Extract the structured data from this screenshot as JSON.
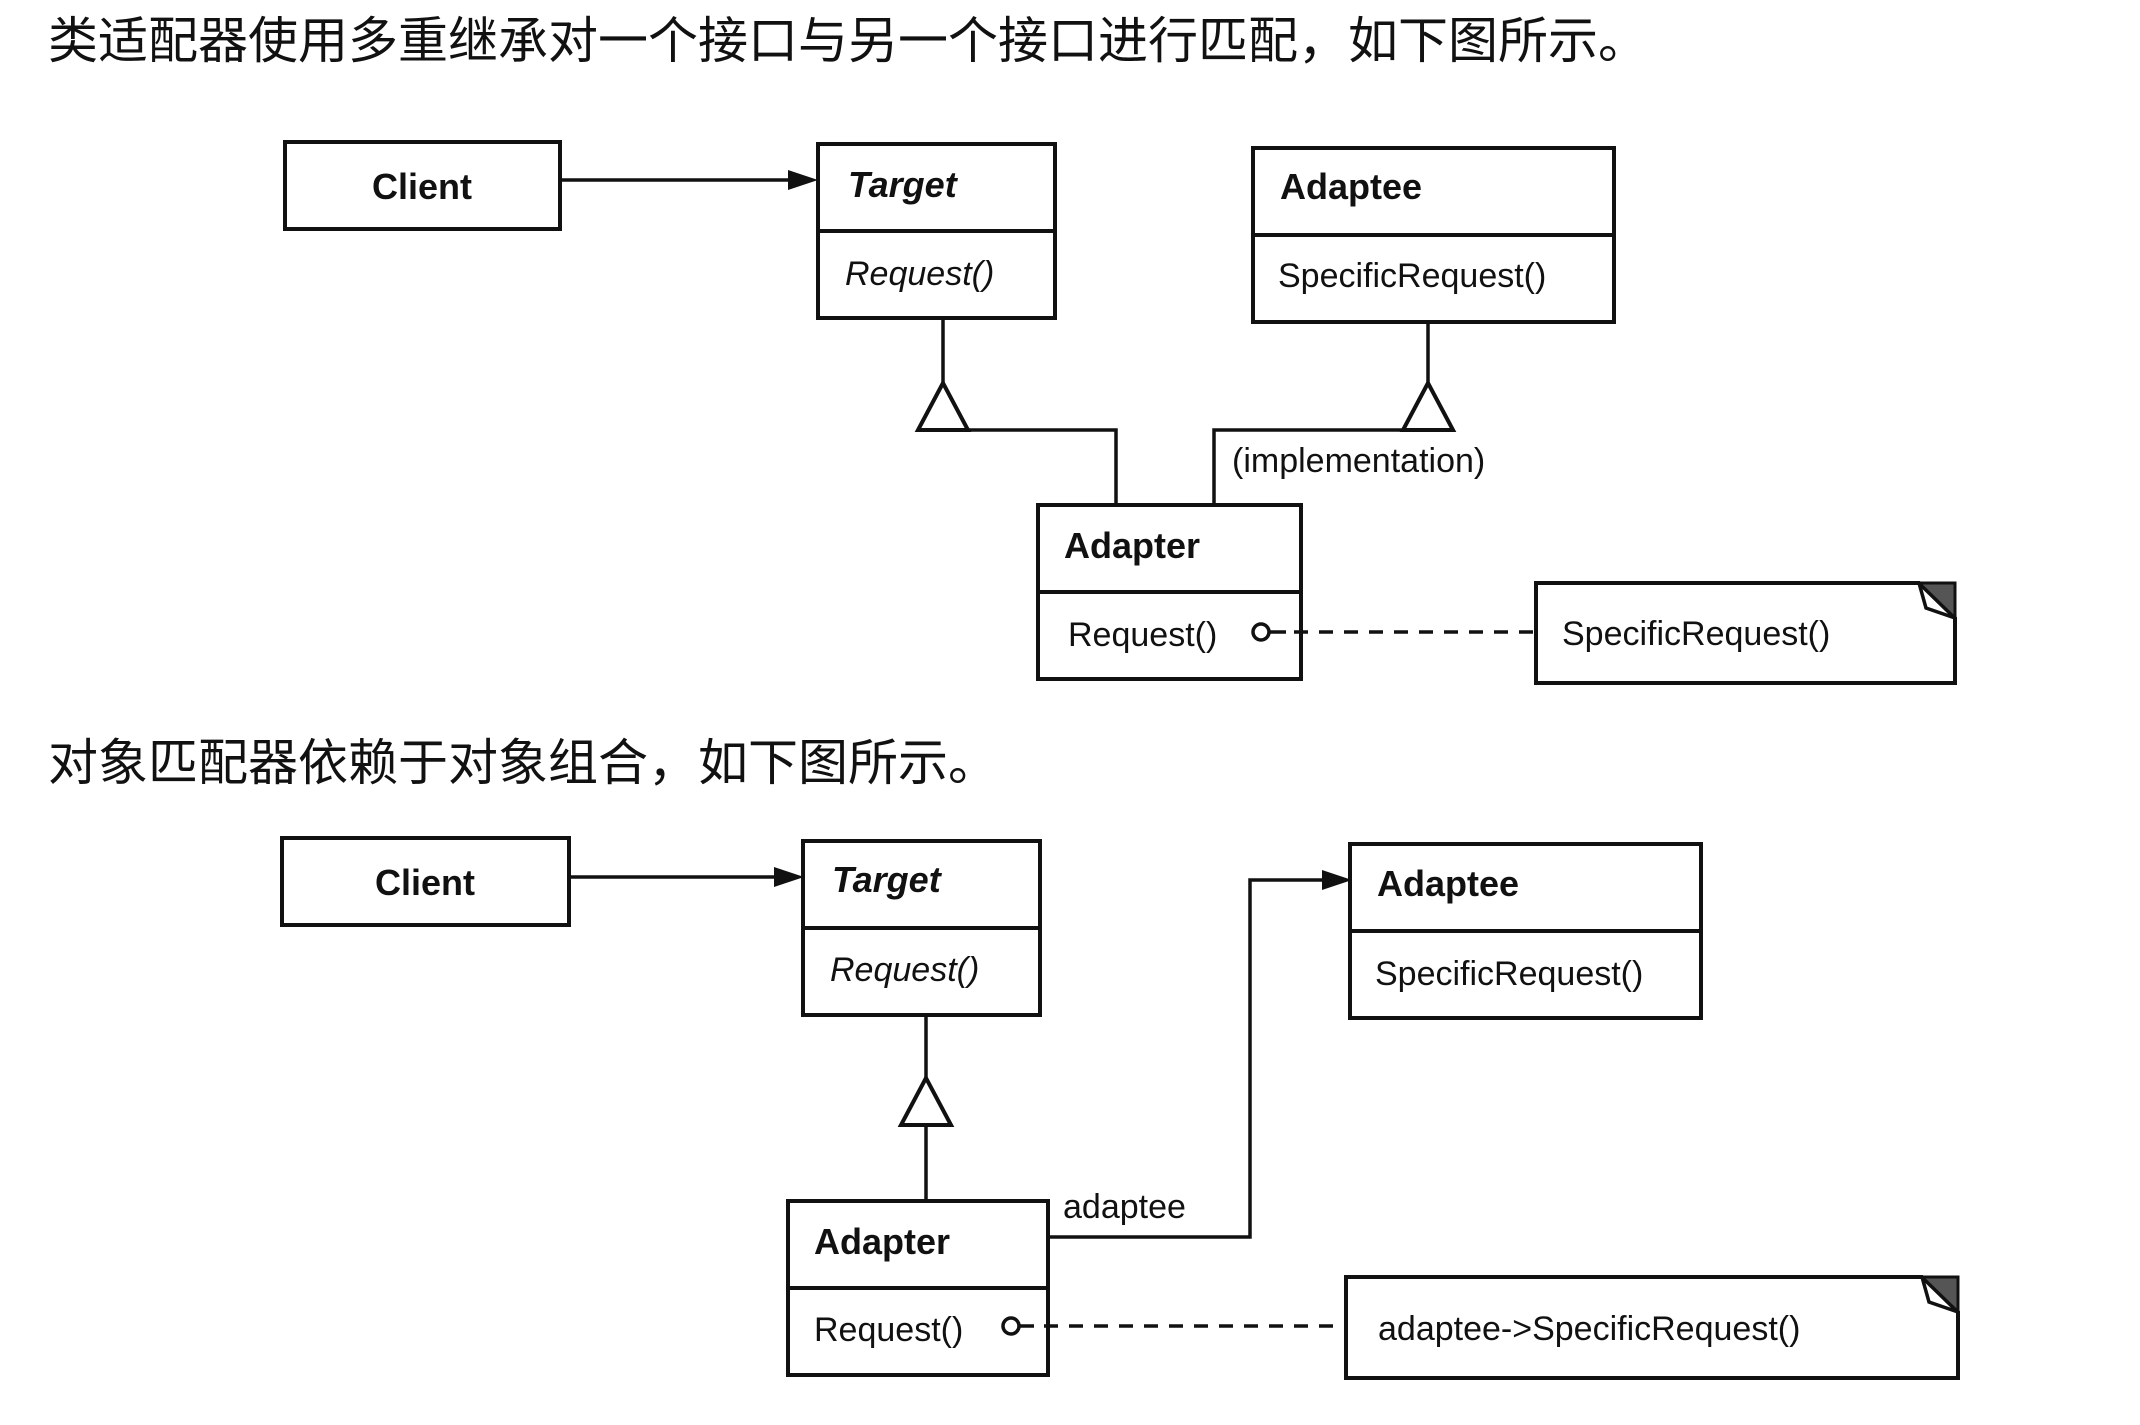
{
  "captions": {
    "class_adapter": "类适配器使用多重继承对一个接口与另一个接口进行匹配，如下图所示。",
    "object_adapter": "对象匹配器依赖于对象组合，如下图所示。"
  },
  "class_adapter_diagram": {
    "client": {
      "name": "Client"
    },
    "target": {
      "name": "Target",
      "operation": "Request()"
    },
    "adaptee": {
      "name": "Adaptee",
      "operation": "SpecificRequest()"
    },
    "adapter": {
      "name": "Adapter",
      "operation": "Request()"
    },
    "implementation_label": "(implementation)",
    "note": "SpecificRequest()"
  },
  "object_adapter_diagram": {
    "client": {
      "name": "Client"
    },
    "target": {
      "name": "Target",
      "operation": "Request()"
    },
    "adaptee": {
      "name": "Adaptee",
      "operation": "SpecificRequest()"
    },
    "adapter": {
      "name": "Adapter",
      "operation": "Request()"
    },
    "association_label": "adaptee",
    "note": "adaptee->SpecificRequest()"
  }
}
